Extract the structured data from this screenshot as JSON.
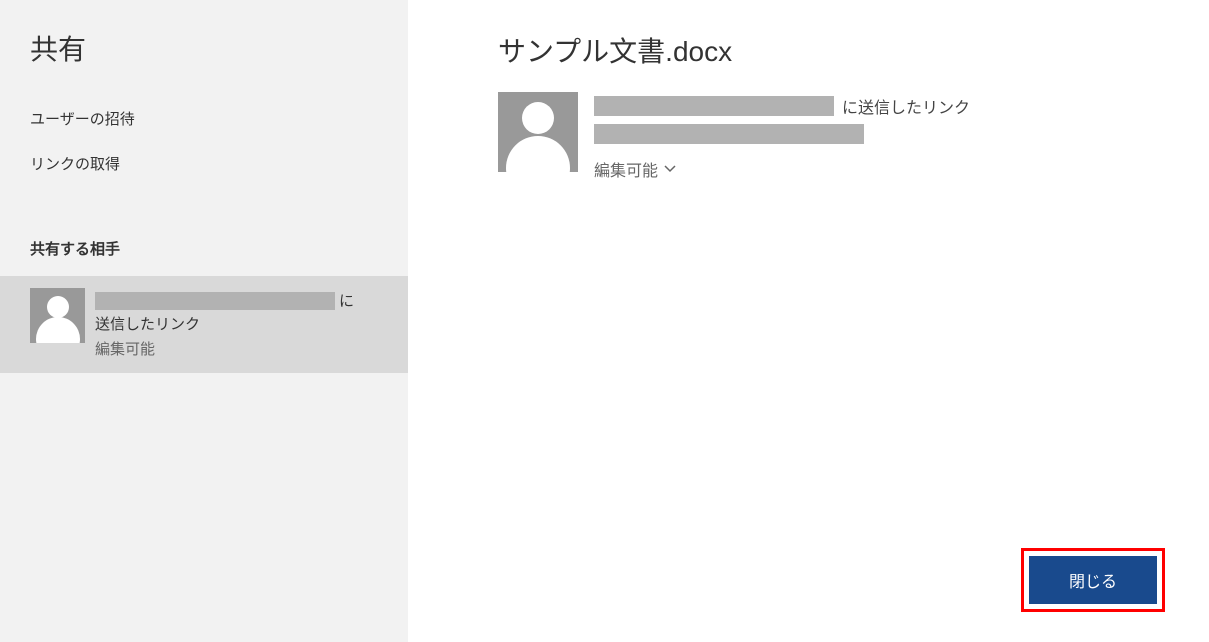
{
  "sidebar": {
    "title": "共有",
    "menu": {
      "invite": "ユーザーの招待",
      "getlink": "リンクの取得"
    },
    "section_label": "共有する相手",
    "share_item": {
      "suffix_particle": "に",
      "line2": "送信したリンク",
      "permission": "編集可能"
    }
  },
  "main": {
    "doc_title": "サンプル文書.docx",
    "share": {
      "suffix_text": "に送信したリンク",
      "permission": "編集可能"
    }
  },
  "buttons": {
    "close": "閉じる"
  }
}
